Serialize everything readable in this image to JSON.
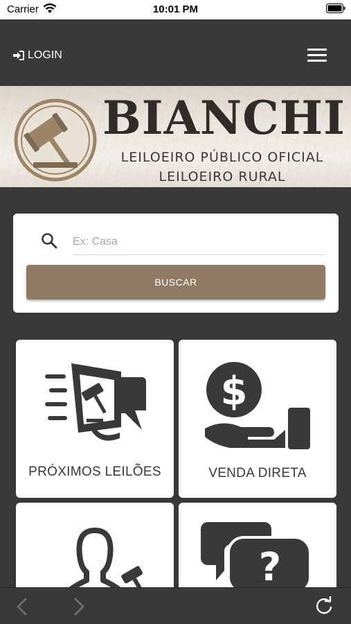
{
  "status_bar": {
    "carrier": "Carrier",
    "time": "10:01 PM"
  },
  "header": {
    "login_label": "LOGIN",
    "menu_icon": "hamburger-icon"
  },
  "banner": {
    "brand": "BIANCHI",
    "line1": "LEILOEIRO PÚBLICO OFICIAL",
    "line2": "LEILOEIRO RURAL"
  },
  "search": {
    "placeholder": "Ex: Casa",
    "value": "",
    "button_label": "BUSCAR"
  },
  "tiles": [
    {
      "label": "PRÓXIMOS LEILÕES",
      "icon": "auction-monitor-icon"
    },
    {
      "label": "VENDA DIRETA",
      "icon": "money-hand-icon"
    },
    {
      "label": "",
      "icon": "auctioneer-icon"
    },
    {
      "label": "",
      "icon": "question-chat-icon"
    }
  ],
  "colors": {
    "background": "#3a3838",
    "accent": "#8f7b62",
    "card": "#ffffff"
  }
}
